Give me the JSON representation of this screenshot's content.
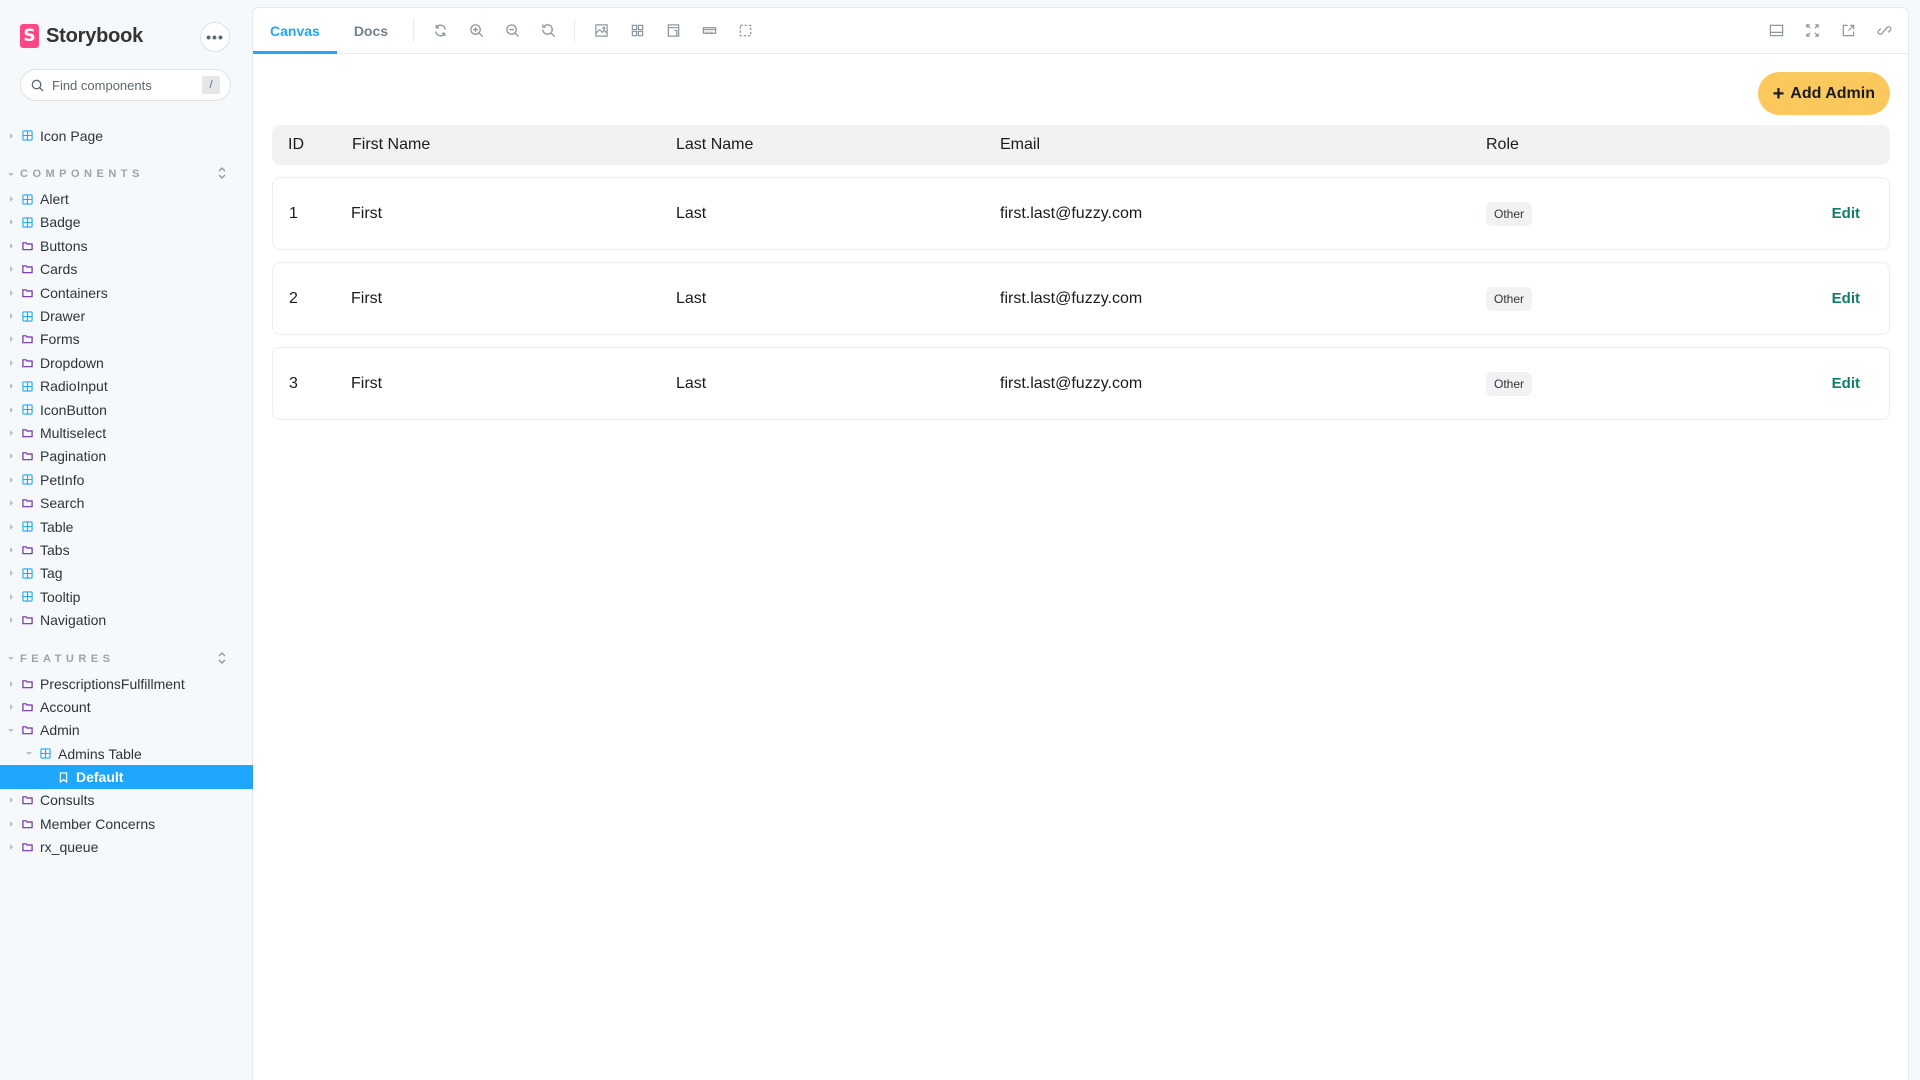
{
  "app": {
    "brand": "Storybook",
    "logo_letter": "S",
    "more_label": "•••",
    "search": {
      "placeholder": "Find components",
      "value": "",
      "shortcut": "/"
    }
  },
  "sidebar": {
    "top_items": [
      {
        "label": "Icon Page",
        "icon": "component-icon"
      }
    ],
    "sections": [
      {
        "title": "COMPONENTS",
        "items": [
          {
            "label": "Alert",
            "icon": "component-icon"
          },
          {
            "label": "Badge",
            "icon": "component-icon"
          },
          {
            "label": "Buttons",
            "icon": "folder-icon"
          },
          {
            "label": "Cards",
            "icon": "folder-icon"
          },
          {
            "label": "Containers",
            "icon": "folder-icon"
          },
          {
            "label": "Drawer",
            "icon": "component-icon"
          },
          {
            "label": "Forms",
            "icon": "folder-icon"
          },
          {
            "label": "Dropdown",
            "icon": "folder-icon"
          },
          {
            "label": "RadioInput",
            "icon": "component-icon"
          },
          {
            "label": "IconButton",
            "icon": "component-icon"
          },
          {
            "label": "Multiselect",
            "icon": "folder-icon"
          },
          {
            "label": "Pagination",
            "icon": "folder-icon"
          },
          {
            "label": "PetInfo",
            "icon": "component-icon"
          },
          {
            "label": "Search",
            "icon": "folder-icon"
          },
          {
            "label": "Table",
            "icon": "component-icon"
          },
          {
            "label": "Tabs",
            "icon": "folder-icon"
          },
          {
            "label": "Tag",
            "icon": "component-icon"
          },
          {
            "label": "Tooltip",
            "icon": "component-icon"
          },
          {
            "label": "Navigation",
            "icon": "folder-icon"
          }
        ]
      },
      {
        "title": "FEATURES",
        "items": [
          {
            "label": "PrescriptionsFulfillment",
            "icon": "folder-icon"
          },
          {
            "label": "Account",
            "icon": "folder-icon"
          },
          {
            "label": "Admin",
            "icon": "folder-icon",
            "open": true
          },
          {
            "label": "Admins Table",
            "icon": "component-icon",
            "open": true,
            "level": 2
          },
          {
            "label": "Default",
            "icon": "story-icon",
            "level": 3,
            "selected": true
          },
          {
            "label": "Consults",
            "icon": "folder-icon"
          },
          {
            "label": "Member Concerns",
            "icon": "folder-icon"
          },
          {
            "label": "rx_queue",
            "icon": "folder-icon"
          }
        ]
      }
    ]
  },
  "toolbar": {
    "tabs": [
      {
        "label": "Canvas",
        "active": true
      },
      {
        "label": "Docs",
        "active": false
      }
    ],
    "tools": [
      "reload-icon",
      "zoom-in-icon",
      "zoom-out-icon",
      "zoom-reset-icon",
      "background-icon",
      "grid-icon",
      "viewport-icon",
      "measure-icon",
      "outline-icon"
    ],
    "right_tools": [
      "addons-panel-icon",
      "fullscreen-icon",
      "open-new-tab-icon",
      "copy-link-icon"
    ]
  },
  "content": {
    "add_button": {
      "label": "Add Admin",
      "icon": "+"
    },
    "table": {
      "columns": [
        "ID",
        "First Name",
        "Last Name",
        "Email",
        "Role"
      ],
      "rows": [
        {
          "id": "1",
          "first": "First",
          "last": "Last",
          "email": "first.last@fuzzy.com",
          "role": "Other",
          "action": "Edit"
        },
        {
          "id": "2",
          "first": "First",
          "last": "Last",
          "email": "first.last@fuzzy.com",
          "role": "Other",
          "action": "Edit"
        },
        {
          "id": "3",
          "first": "First",
          "last": "Last",
          "email": "first.last@fuzzy.com",
          "role": "Other",
          "action": "Edit"
        }
      ]
    }
  },
  "colors": {
    "accent": "#1ea7fd",
    "brand": "#ff4785",
    "add_button": "#fbc85e",
    "edit_link": "#107e6c",
    "folder_icon": "#6f2cac",
    "component_icon": "#1ea7fd"
  }
}
